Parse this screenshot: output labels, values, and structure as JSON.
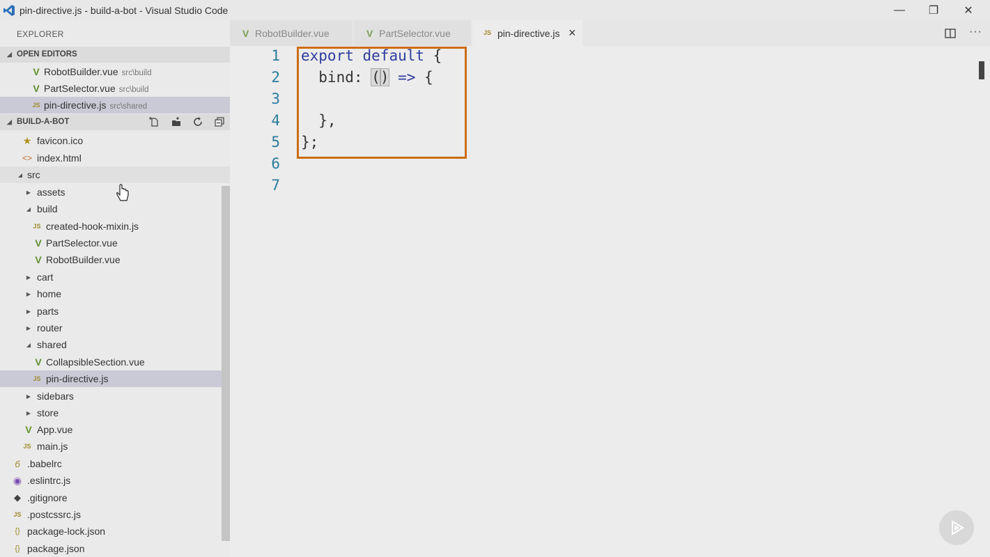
{
  "window": {
    "title": "pin-directive.js - build-a-bot - Visual Studio Code",
    "minimize": "—",
    "restore": "❐",
    "close": "✕"
  },
  "sidebar": {
    "title": "EXPLORER",
    "open_editors": {
      "label": "OPEN EDITORS",
      "items": [
        {
          "name": "RobotBuilder.vue",
          "path": "src\\build",
          "type": "vue"
        },
        {
          "name": "PartSelector.vue",
          "path": "src\\build",
          "type": "vue"
        },
        {
          "name": "pin-directive.js",
          "path": "src\\shared",
          "type": "js"
        }
      ]
    },
    "project": {
      "label": "BUILD-A-BOT",
      "tree": [
        {
          "name": "favicon.ico",
          "type": "star"
        },
        {
          "name": "index.html",
          "type": "html"
        },
        {
          "name": "src",
          "type": "folder-open"
        },
        {
          "name": "assets",
          "type": "folder"
        },
        {
          "name": "build",
          "type": "folder-open"
        },
        {
          "name": "created-hook-mixin.js",
          "type": "js"
        },
        {
          "name": "PartSelector.vue",
          "type": "vue"
        },
        {
          "name": "RobotBuilder.vue",
          "type": "vue"
        },
        {
          "name": "cart",
          "type": "folder"
        },
        {
          "name": "home",
          "type": "folder"
        },
        {
          "name": "parts",
          "type": "folder"
        },
        {
          "name": "router",
          "type": "folder"
        },
        {
          "name": "shared",
          "type": "folder-open"
        },
        {
          "name": "CollapsibleSection.vue",
          "type": "vue"
        },
        {
          "name": "pin-directive.js",
          "type": "js"
        },
        {
          "name": "sidebars",
          "type": "folder"
        },
        {
          "name": "store",
          "type": "folder"
        },
        {
          "name": "App.vue",
          "type": "vue"
        },
        {
          "name": "main.js",
          "type": "js"
        },
        {
          "name": ".babelrc",
          "type": "babel"
        },
        {
          "name": ".eslintrc.js",
          "type": "eslint"
        },
        {
          "name": ".gitignore",
          "type": "git"
        },
        {
          "name": ".postcssrc.js",
          "type": "js"
        },
        {
          "name": "package-lock.json",
          "type": "json"
        },
        {
          "name": "package.json",
          "type": "json"
        }
      ]
    }
  },
  "tabs": [
    {
      "label": "RobotBuilder.vue",
      "type": "vue"
    },
    {
      "label": "PartSelector.vue",
      "type": "vue"
    },
    {
      "label": "pin-directive.js",
      "type": "js",
      "close": "×"
    }
  ],
  "editor": {
    "lines": [
      {
        "num": "1"
      },
      {
        "num": "2"
      },
      {
        "num": "3"
      },
      {
        "num": "4"
      },
      {
        "num": "5"
      },
      {
        "num": "6"
      },
      {
        "num": "7"
      }
    ],
    "code": {
      "l1_kw1": "export",
      "l1_kw2": "default",
      "l1_rest": " {",
      "l2_pre": "  bind: ",
      "l2_paren_open": "(",
      "l2_paren_close": ")",
      "l2_arrow": " =>",
      "l2_rest": " {",
      "l4": "  },",
      "l5": "};"
    }
  },
  "colors": {
    "accent_box": "#cc6d10",
    "keyword": "#2e3d9e",
    "line_number": "#2b7b9c",
    "vue_icon": "#5f8f2f",
    "js_icon": "#a08a2c"
  }
}
